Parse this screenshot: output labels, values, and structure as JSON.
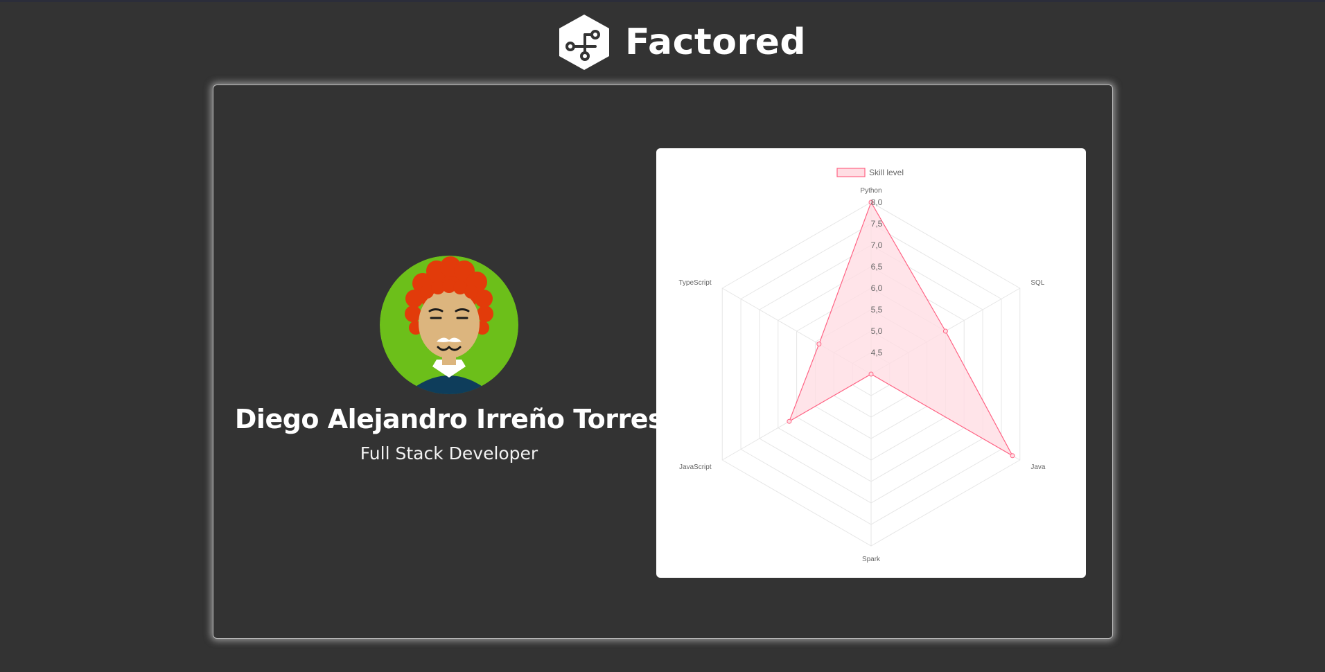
{
  "brand": {
    "name": "Factored",
    "colors": {
      "background": "#333333",
      "text": "#ffffff"
    }
  },
  "profile": {
    "name": "Diego Alejandro Irreño Torres",
    "role": "Full Stack Developer",
    "avatar": "illustrated-avatar-red-curly-hair-mustache",
    "avatar_colors": {
      "background": "#6cbf1a",
      "hair": "#e23b0a",
      "skin": "#dcb57e",
      "shirt": "#0e3d5b"
    }
  },
  "chart_data": {
    "type": "radar",
    "labels": [
      "Python",
      "SQL",
      "Java",
      "Spark",
      "JavaScript",
      "TypeScript"
    ],
    "series": [
      {
        "name": "Skill level",
        "values": [
          8.0,
          6.0,
          7.8,
          4.0,
          6.2,
          5.4
        ]
      }
    ],
    "scale": {
      "min": 4.0,
      "max": 8.0,
      "step": 0.5,
      "ticks": [
        "4,5",
        "5,0",
        "5,5",
        "6,0",
        "6,5",
        "7,0",
        "7,5",
        "8,0"
      ]
    },
    "legend": "top",
    "grid": true,
    "colors": {
      "line": "#ff6384",
      "fill": "#ffdde3",
      "grid": "#e6e6e6"
    }
  }
}
